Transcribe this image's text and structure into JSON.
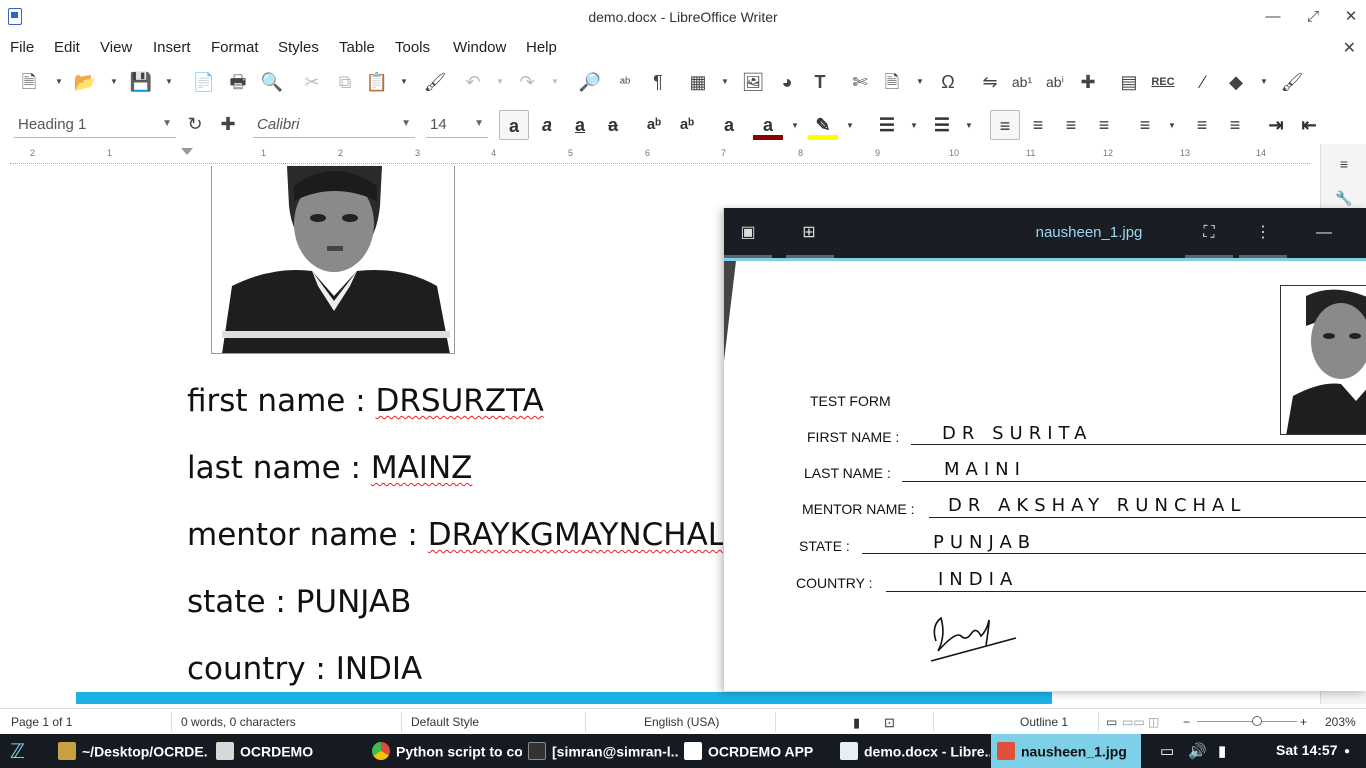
{
  "window": {
    "title": "demo.docx - LibreOffice Writer"
  },
  "menu": [
    "File",
    "Edit",
    "View",
    "Insert",
    "Format",
    "Styles",
    "Table",
    "Tools",
    "Window",
    "Help"
  ],
  "formatting": {
    "paragraph_style": "Heading 1",
    "font_name": "Calibri",
    "font_size": "14"
  },
  "ruler": {
    "numbers": [
      "2",
      "1",
      "1",
      "2",
      "3",
      "4",
      "5",
      "6",
      "7",
      "8",
      "9",
      "10",
      "11",
      "12",
      "13",
      "14"
    ]
  },
  "document": {
    "lines": [
      {
        "label": "first name : ",
        "value": "DRSURZTA"
      },
      {
        "label": "last name : ",
        "value": "MAINZ"
      },
      {
        "label": "mentor name : ",
        "value": "DRAYKGMAYNCHAL"
      },
      {
        "label": "state : ",
        "value": "PUNJAB"
      },
      {
        "label": "country : ",
        "value": "INDIA"
      }
    ]
  },
  "statusbar": {
    "page": "Page 1 of 1",
    "words": "0 words, 0 characters",
    "page_style": "Default Style",
    "language": "English (USA)",
    "outline": "Outline 1",
    "zoom": "203%"
  },
  "image_viewer": {
    "filename": "nausheen_1.jpg",
    "form": {
      "heading": "TEST FORM",
      "fields": [
        {
          "label": "FIRST NAME :",
          "value": "DR  SURITA"
        },
        {
          "label": "LAST NAME :",
          "value": "MAINI"
        },
        {
          "label": "MENTOR NAME :",
          "value": "DR  AKSHAY  RUNCHAL"
        },
        {
          "label": "STATE :",
          "value": "PUNJAB"
        },
        {
          "label": "COUNTRY :",
          "value": "INDIA"
        }
      ]
    }
  },
  "taskbar": {
    "tasks": [
      {
        "label": "~/Desktop/OCRDE...",
        "color": "#c8a040"
      },
      {
        "label": "OCRDEMO",
        "color": "#d8d8d8"
      },
      {
        "label": "Python script to co...",
        "color": "#e04a3a"
      },
      {
        "label": "[simran@simran-l...",
        "color": "#333333"
      },
      {
        "label": "OCRDEMO APP",
        "color": "#ffffff"
      },
      {
        "label": "demo.docx - Libre...",
        "color": "#e8eef8"
      },
      {
        "label": "nausheen_1.jpg",
        "color": "#e0503a"
      }
    ],
    "clock": "Sat 14:57"
  }
}
